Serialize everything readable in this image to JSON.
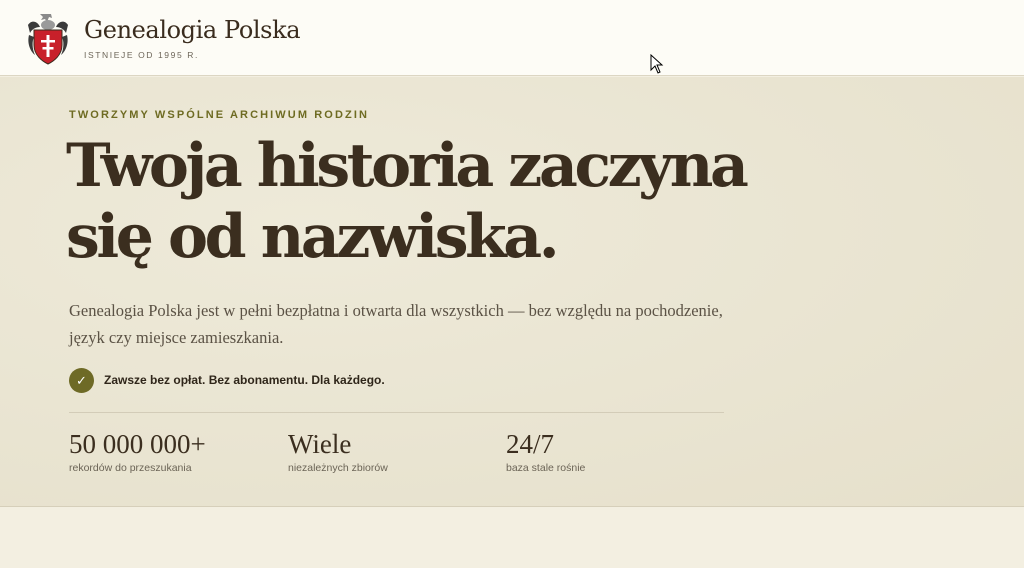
{
  "header": {
    "brand_name": "Genealogia Polska",
    "brand_tagline": "ISTNIEJE OD 1995 R.",
    "logo_icon": "coat-of-arms-icon"
  },
  "hero": {
    "eyebrow": "TWORZYMY WSPÓLNE ARCHIWUM RODZIN",
    "headline_line1": "Twoja historia zaczyna",
    "headline_line2": "się od nazwiska.",
    "lead": "Genealogia Polska jest w pełni bezpłatna i otwarta dla wszystkich — bez względu na pochodzenie, język czy miejsce zamieszkania.",
    "check_icon": "checkmark-icon",
    "check_text": "Zawsze bez opłat. Bez abonamentu. Dla każdego.",
    "stats": [
      {
        "value": "50 000 000+",
        "label": "rekordów do przeszukania"
      },
      {
        "value": "Wiele",
        "label": "niezależnych zbiorów"
      },
      {
        "value": "24/7",
        "label": "baza stale rośnie"
      }
    ]
  },
  "colors": {
    "accent_olive": "#6e6b22",
    "text_dark": "#3b2e1f",
    "header_bg": "#fdfcf6",
    "hero_bg": "#e9e4d1",
    "shield_red": "#c8202a"
  }
}
